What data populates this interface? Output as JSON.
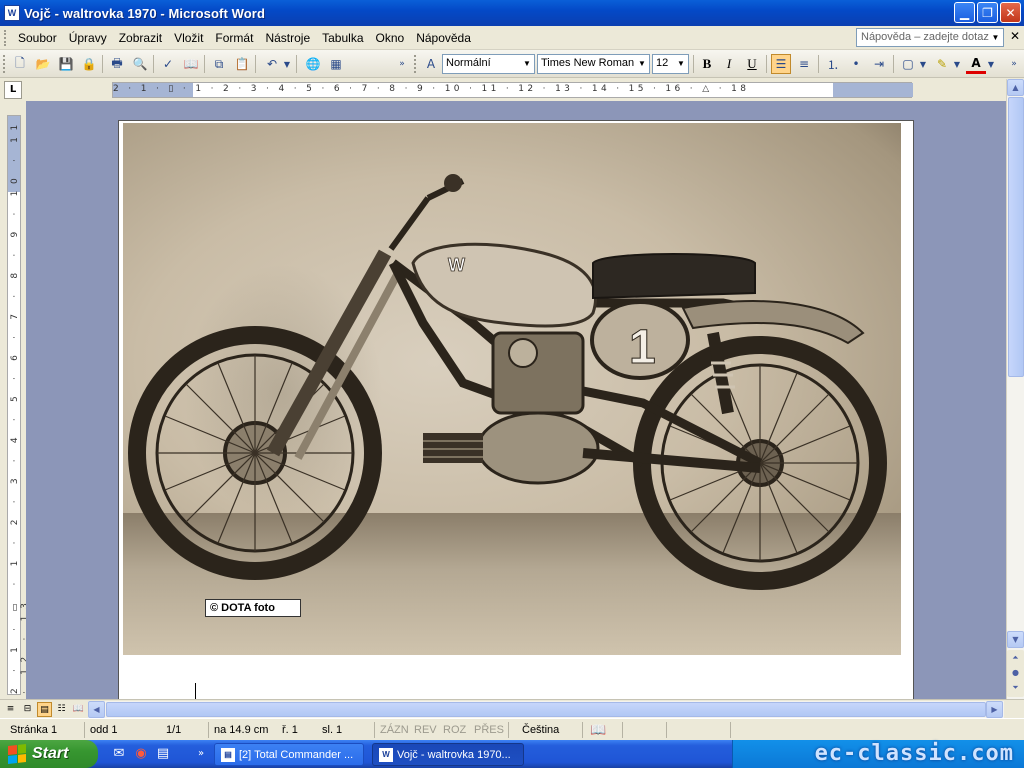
{
  "window": {
    "title": "Vojč - waltrovka 1970 - Microsoft Word",
    "app_icon": "W"
  },
  "menubar": {
    "items": [
      "Soubor",
      "Úpravy",
      "Zobrazit",
      "Vložit",
      "Formát",
      "Nástroje",
      "Tabulka",
      "Okno",
      "Nápověda"
    ],
    "help_placeholder": "Nápověda – zadejte dotaz"
  },
  "toolbar": {
    "style": "Normální",
    "font": "Times New Roman",
    "size": "12",
    "bold_label": "B",
    "italic_label": "I",
    "underline_label": "U"
  },
  "ruler": {
    "tab_selector": "L",
    "numbers": "2 · 1 · ▯ · 1 · 2 · 3 · 4 · 5 · 6 · 7 · 8 · 9 · 10 · 11 · 12 · 13 · 14 · 15 · 16 · △ · 18",
    "vertical_numbers": "2 · 1 · ▯ · 1 · 2 · 3 · 4 · 5 · 6 · 7 · 8 · 9 · 10 · 11 · 12 · 13"
  },
  "document": {
    "photo_caption": "© DOTA foto",
    "tank_logo": "W",
    "number_plate": "1"
  },
  "statusbar": {
    "page": "Stránka  1",
    "section": "odd  1",
    "page_of": "1/1",
    "position": "na  14.9 cm",
    "line": "ř.  1",
    "column": "sl.  1",
    "rec": "ZÁZN",
    "rev": "REV",
    "ext": "ROZ",
    "ovr": "PŘES",
    "language": "Čeština"
  },
  "taskbar": {
    "start_label": "Start",
    "tasks": [
      {
        "label": "[2] Total Commander ..."
      },
      {
        "label": "Vojč - waltrovka 1970..."
      }
    ],
    "watermark": "ec-classic.com"
  },
  "colors": {
    "titlebar": "#0449c7",
    "workspace": "#8c96b8",
    "start_green": "#379630"
  }
}
